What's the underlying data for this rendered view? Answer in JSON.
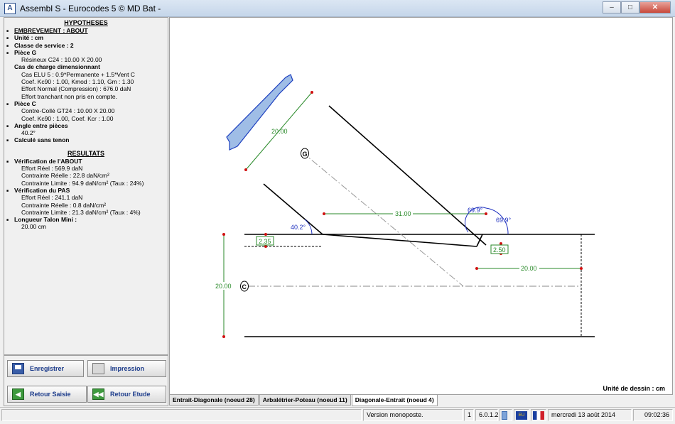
{
  "window": {
    "title": "Assembl S - Eurocodes 5 © MD Bat -",
    "controls": {
      "minimize": "–",
      "maximize": "□",
      "close": "✕"
    }
  },
  "hypotheses": {
    "title": "HYPOTHESES",
    "lines": [
      {
        "style": "bullet-ul",
        "text": "EMBREVEMENT : ABOUT"
      },
      {
        "style": "bullet",
        "text": "Unité : cm"
      },
      {
        "style": "bullet",
        "text": "Classe de service : 2"
      },
      {
        "style": "bullet",
        "text": "Pièce G"
      },
      {
        "style": "sub",
        "text": "Résineux C24 : 10.00 X 20.00"
      },
      {
        "style": "sub2",
        "text": "Cas de charge dimensionnant"
      },
      {
        "style": "sub",
        "text": "Cas ELU 5 :  0.9*Permanente + 1.5*Vent C"
      },
      {
        "style": "sub",
        "text": "Coef. Kc90 : 1.00, Kmod : 1.10, Gm : 1.30"
      },
      {
        "style": "sub",
        "text": "Effort Normal (Compression) : 676.0 daN"
      },
      {
        "style": "sub",
        "text": "Effort tranchant non pris en compte."
      },
      {
        "style": "bullet",
        "text": "Pièce C"
      },
      {
        "style": "sub",
        "text": "Contre-Collé GT24 : 10.00 X 20.00"
      },
      {
        "style": "sub",
        "text": "Coef. Kc90 : 1.00, Coef. Kcr : 1.00"
      },
      {
        "style": "bullet",
        "text": "Angle entre pièces"
      },
      {
        "style": "sub",
        "text": "40.2°"
      },
      {
        "style": "bullet",
        "text": "Calculé sans tenon"
      }
    ]
  },
  "resultats": {
    "title": "RESULTATS",
    "lines": [
      {
        "style": "bullet",
        "text": "Vérification de l'ABOUT"
      },
      {
        "style": "sub",
        "text": "Effort Réel : 569.9 daN"
      },
      {
        "style": "sub",
        "text": "Contrainte Réelle : 22.8 daN/cm²"
      },
      {
        "style": "sub",
        "text": "Contrainte Limite : 94.9 daN/cm² (Taux : 24%)"
      },
      {
        "style": "bullet",
        "text": "Vérification du PAS"
      },
      {
        "style": "sub",
        "text": "Effort Réel : 241.1 daN"
      },
      {
        "style": "sub",
        "text": "Contrainte Réelle : 0.8 daN/cm²"
      },
      {
        "style": "sub",
        "text": "Contrainte Limite : 21.3 daN/cm² (Taux : 4%)"
      },
      {
        "style": "bullet",
        "text": "Longueur Talon Mini :"
      },
      {
        "style": "sub",
        "text": "20.00 cm"
      }
    ]
  },
  "buttons": {
    "save": "Enregistrer",
    "print": "Impression",
    "back_input": "Retour Saisie",
    "back_study": "Retour Etude"
  },
  "drawing": {
    "unit_label": "Unité de dessin : cm",
    "labels": {
      "dim_g_width": "20.00",
      "piece_g": "G",
      "piece_c": "C",
      "angle_pieces": "40.2°",
      "dim_horizontal": "31.00",
      "angle_a": "69.9°",
      "angle_b": "69.9°",
      "depth_left": "2.35",
      "depth_right": "2.50",
      "dim_heel": "20.00",
      "dim_c_height": "20.00"
    }
  },
  "tabs": [
    {
      "label": "Entrait-Diagonale (noeud 28)",
      "active": false
    },
    {
      "label": "Arbalétrier-Poteau (noeud 11)",
      "active": false
    },
    {
      "label": "Diagonale-Entrait (noeud 4)",
      "active": true
    }
  ],
  "status": {
    "mode": "Version monoposte.",
    "count": "1",
    "version": "6.0.1.2",
    "eu_flag": "EU",
    "date": "mercredi 13 août 2014",
    "time": "09:02:36"
  }
}
